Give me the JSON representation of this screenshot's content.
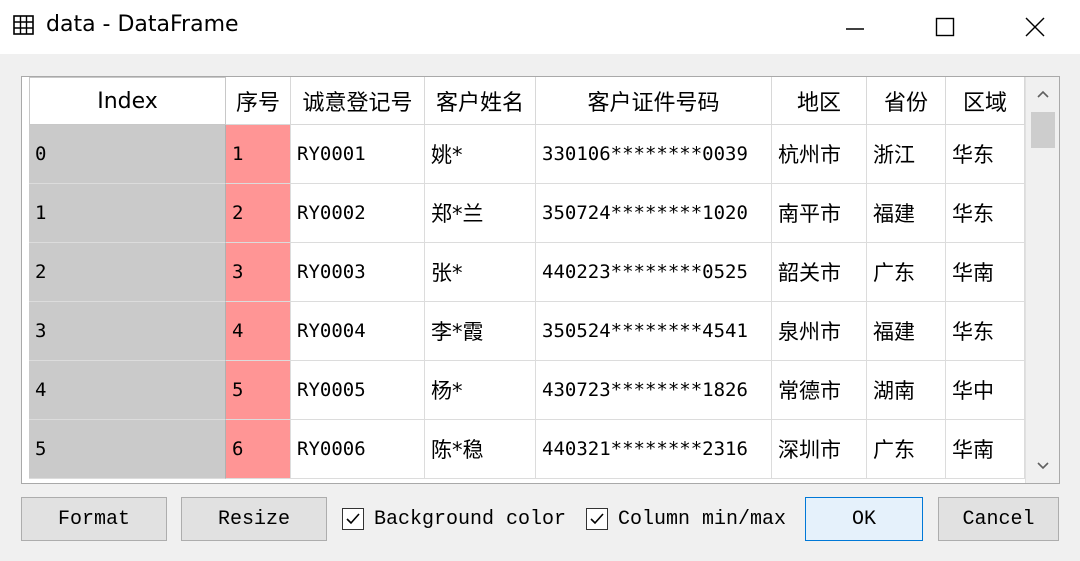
{
  "window": {
    "title": "data - DataFrame"
  },
  "table": {
    "headers": [
      "Index",
      "序号",
      "诚意登记号",
      "客户姓名",
      "客户证件号码",
      "地区",
      "省份",
      "区域"
    ],
    "rows": [
      [
        "0",
        "1",
        "RY0001",
        "姚*",
        "330106********0039",
        "杭州市",
        "浙江",
        "华东"
      ],
      [
        "1",
        "2",
        "RY0002",
        "郑*兰",
        "350724********1020",
        "南平市",
        "福建",
        "华东"
      ],
      [
        "2",
        "3",
        "RY0003",
        "张*",
        "440223********0525",
        "韶关市",
        "广东",
        "华南"
      ],
      [
        "3",
        "4",
        "RY0004",
        "李*霞",
        "350524********4541",
        "泉州市",
        "福建",
        "华东"
      ],
      [
        "4",
        "5",
        "RY0005",
        "杨*",
        "430723********1826",
        "常德市",
        "湖南",
        "华中"
      ],
      [
        "5",
        "6",
        "RY0006",
        "陈*稳",
        "440321********2316",
        "深圳市",
        "广东",
        "华南"
      ]
    ]
  },
  "buttons": {
    "format": "Format",
    "resize": "Resize",
    "ok": "OK",
    "cancel": "Cancel"
  },
  "checkboxes": {
    "background_color": {
      "label": "Background color",
      "checked": true
    },
    "column_minmax": {
      "label": "Column min/max",
      "checked": true
    }
  },
  "colors": {
    "index_column": "#cacaca",
    "sequence_column": "#ff9595",
    "ok_button_border": "#0078d7"
  },
  "icons": {
    "app": "table-icon",
    "minimize": "minimize-icon",
    "maximize": "maximize-icon",
    "close": "close-icon",
    "scroll_up": "chevron-up-icon",
    "scroll_down": "chevron-down-icon",
    "checkbox": "checkmark-icon"
  }
}
